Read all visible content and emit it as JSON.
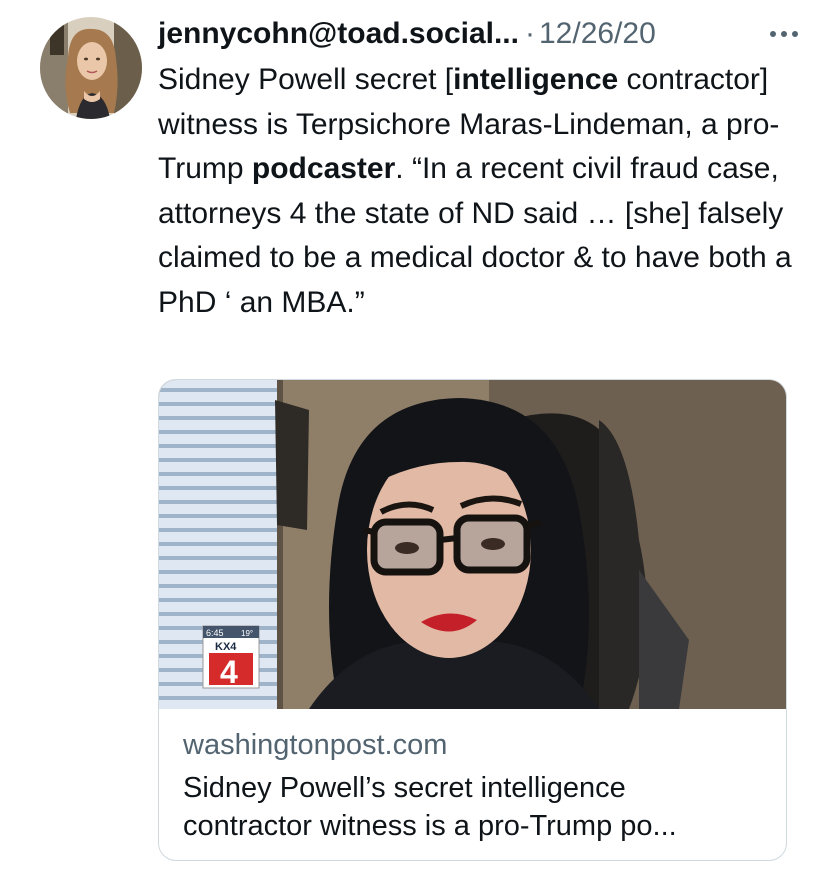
{
  "tweet": {
    "handle": "jennycohn@toad.social...",
    "separator": "·",
    "date": "12/26/20",
    "more_icon": "more-dots-icon",
    "text_parts": [
      "Sidney Powell secret [",
      "intelligence",
      " contractor] witness is Terpsichore Maras-Lindeman, a pro-Trump ",
      "podcaster",
      ". “In a recent civil fraud case, attorneys 4 the state of ND said … [she] falsely claimed to be a medical doctor & to have both a PhD ‘ an MBA.”"
    ]
  },
  "card": {
    "domain": "washingtonpost.com",
    "title_line1": "Sidney Powell’s secret intelligence",
    "title_line2": "contractor witness is a pro-Trump po...",
    "image": {
      "logo_time": "6:45",
      "logo_temp": "19°",
      "logo_station": "KX4",
      "logo_channel": "4"
    }
  }
}
